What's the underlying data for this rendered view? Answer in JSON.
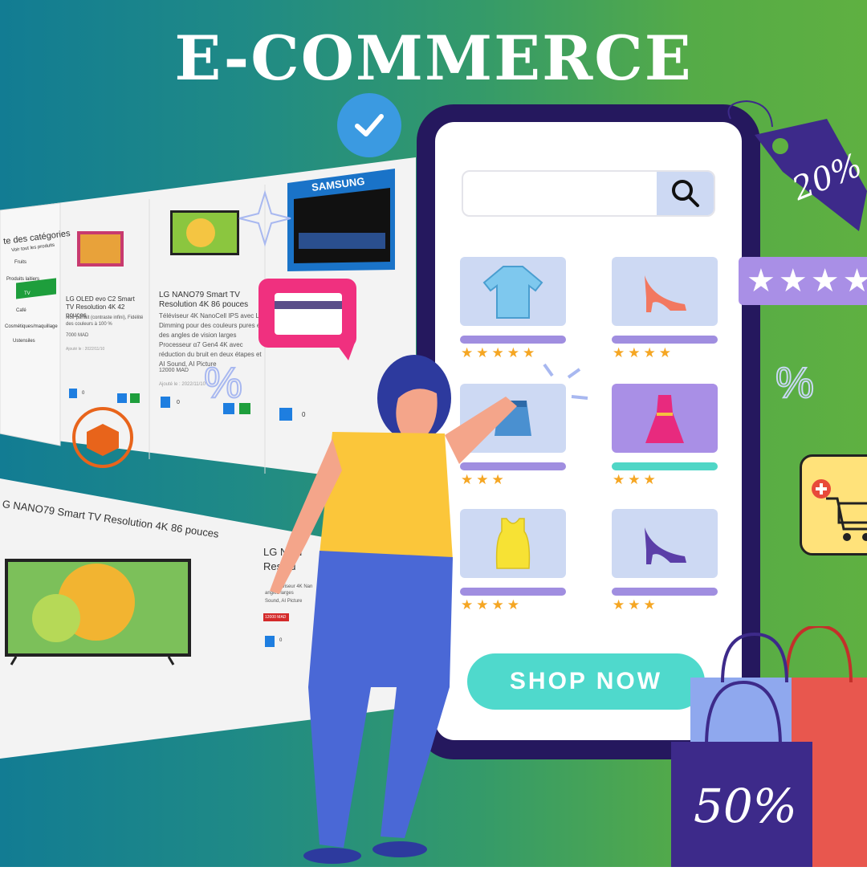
{
  "title": "E-COMMERCE",
  "search": {
    "placeholder": ""
  },
  "shop_button": "SHOP NOW",
  "tag_discount": "20%",
  "bag_discount": "50%",
  "percent_symbols": [
    "%",
    "%"
  ],
  "rating_stars_display": "★★★★",
  "grid_products": [
    {
      "name": "shirt",
      "stars": "★★★★★",
      "bar": "purple"
    },
    {
      "name": "high-heel",
      "stars": "★★★★",
      "bar": "purple"
    },
    {
      "name": "skirt",
      "stars": "★★★",
      "bar": "purple"
    },
    {
      "name": "dress",
      "stars": "★★★",
      "bar": "teal"
    },
    {
      "name": "tank-top",
      "stars": "★★★★",
      "bar": "purple"
    },
    {
      "name": "heel-purple",
      "stars": "★★★",
      "bar": "purple"
    }
  ],
  "store_panel": {
    "sidebar_title": "te des catégories",
    "sidebar_items": [
      "Voir tout les produits",
      "Fruits",
      "Produits laitiers",
      "TV",
      "Café",
      "Cosmétiques/maquillage",
      "Ustensiles"
    ],
    "products": [
      {
        "name": "LG OLED evo C2 Smart TV Resolution 4K 42 pouces",
        "desc": "Noir parfait (contraste infini), Fidélité des couleurs à 100 %",
        "price": "7000 MAD",
        "added": "Ajouté le : 2022/11/10",
        "qty": "0"
      },
      {
        "name": "LG NANO79 Smart TV Resolution 4K 86 pouces",
        "desc": [
          "Téléviseur 4K NanoCell IPS avec Local",
          "Dimming pour des couleurs pures et",
          "des angles de vision larges",
          "Processeur α7 Gen4 4K avec",
          "réduction du bruit en deux étapes et",
          "AI Sound, AI Picture"
        ],
        "price": "12000 MAD",
        "added": "Ajouté le : 2022/11/10",
        "qty": "0"
      },
      {
        "name": "SAMSUNG",
        "qty": "0"
      }
    ],
    "detail_title": "G NANO79 Smart TV Resolution 4K 86 pouces",
    "detail_side": [
      "LG NAN",
      "Resolu"
    ],
    "detail_desc": [
      "Téléviseur 4K Nan",
      "angles larges",
      "Sound, AI Picture"
    ],
    "detail_price": "12000 MAD",
    "detail_qty": "0"
  },
  "colors": {
    "phone": "#25185e",
    "accent_teal": "#4fd9cc",
    "accent_purple": "#a98fe6",
    "star": "#f5a623",
    "tag": "#3d2a8a",
    "card_pink": "#f0307f"
  }
}
